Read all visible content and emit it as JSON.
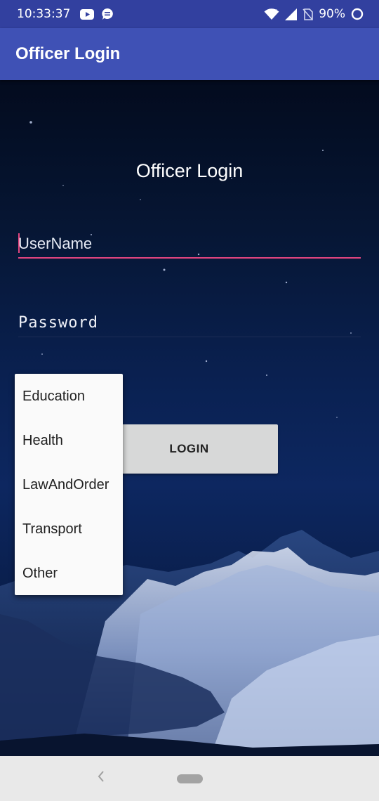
{
  "status_bar": {
    "time": "10:33:37",
    "battery": "90%",
    "icons": [
      "youtube-icon",
      "message-icon",
      "wifi-icon",
      "signal-icon",
      "no-sim-icon",
      "battery-icon"
    ]
  },
  "app_bar": {
    "title": "Officer Login"
  },
  "form": {
    "heading": "Officer Login",
    "username_placeholder": "UserName",
    "username_value": "",
    "password_placeholder": "Password",
    "password_value": "",
    "login_label": "LOGIN"
  },
  "dropdown": {
    "options": [
      "Education",
      "Health",
      "LawAndOrder",
      "Transport",
      "Other"
    ]
  },
  "colors": {
    "app_bar": "#3f51b5",
    "status_bar": "#32409f",
    "accent": "#e3457f"
  }
}
